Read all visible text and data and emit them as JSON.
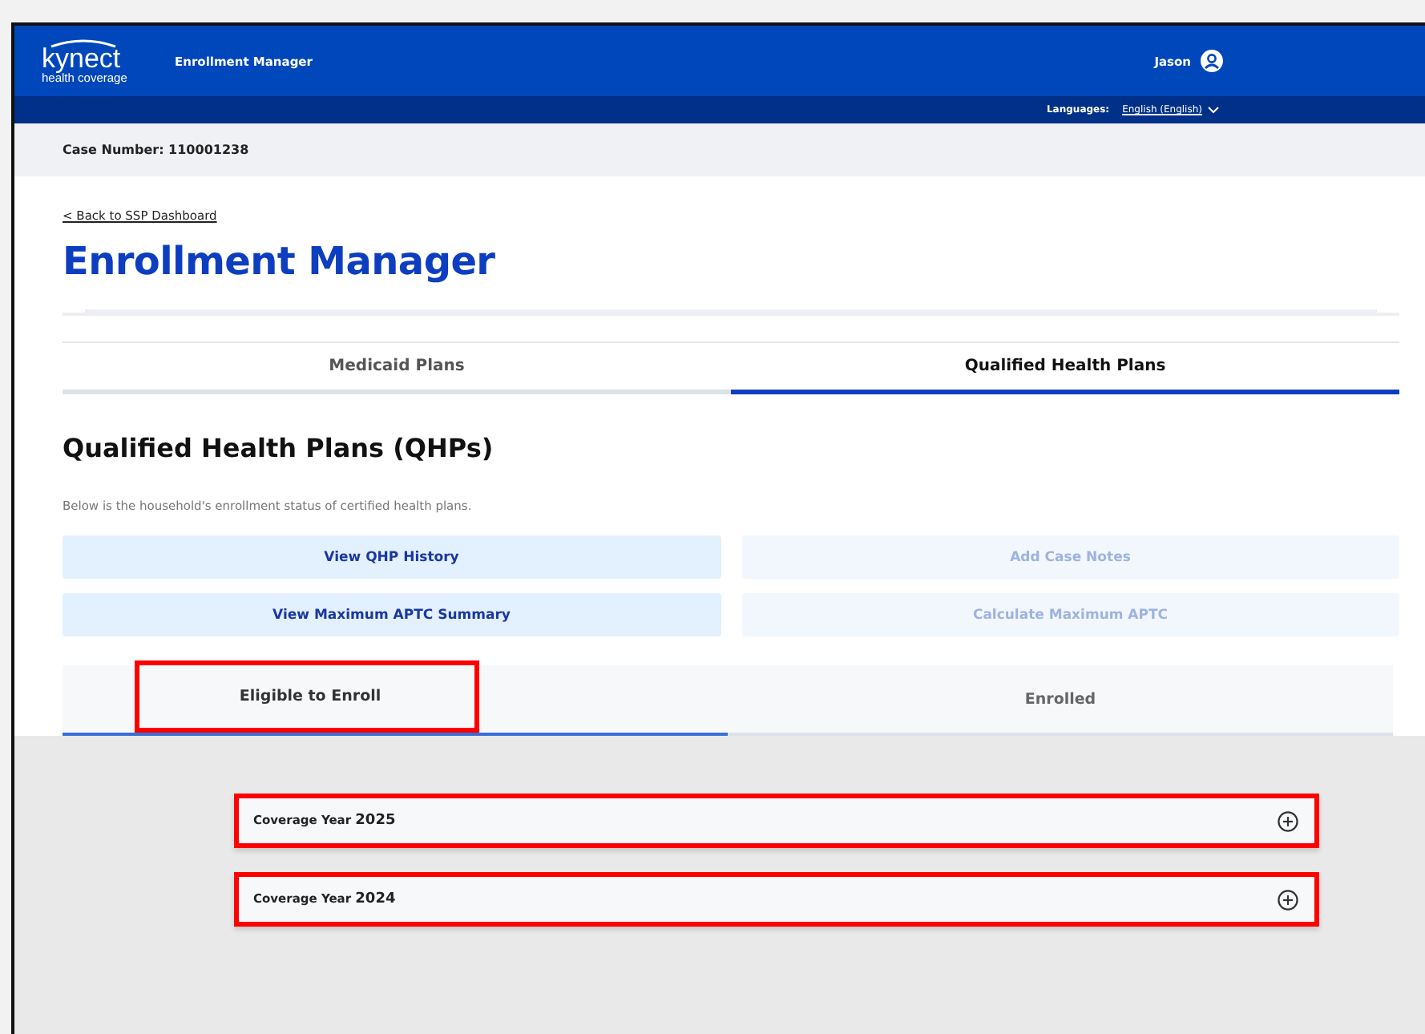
{
  "header": {
    "logo_main": "kynect",
    "logo_sub": "health coverage",
    "app_name": "Enrollment Manager",
    "user_name": "Jason",
    "languages_label": "Languages:",
    "language": "English (English)"
  },
  "case_bar": {
    "text": "Case Number: 110001238"
  },
  "back_link": "< Back to SSP Dashboard",
  "page_title": "Enrollment Manager",
  "tabs": [
    {
      "label": "Medicaid Plans",
      "selected": false
    },
    {
      "label": "Qualified Health Plans",
      "selected": true
    }
  ],
  "section_title": "Qualified Health Plans (QHPs)",
  "description": "Below is the household's enrollment status of certified health plans.",
  "actions": [
    {
      "label": "View QHP History",
      "disabled": false
    },
    {
      "label": "Add Case Notes",
      "disabled": true
    },
    {
      "label": "View Maximum APTC Summary",
      "disabled": false
    },
    {
      "label": "Calculate Maximum APTC",
      "disabled": true
    }
  ],
  "subtabs": [
    {
      "label": "Eligible to Enroll",
      "selected": true,
      "highlighted": true
    },
    {
      "label": "Enrolled",
      "selected": false,
      "highlighted": false
    }
  ],
  "coverage_years": [
    {
      "label": "Coverage Year",
      "year": "2025",
      "expanded": false,
      "highlighted": true
    },
    {
      "label": "Coverage Year",
      "year": "2024",
      "expanded": false,
      "highlighted": true
    }
  ]
}
